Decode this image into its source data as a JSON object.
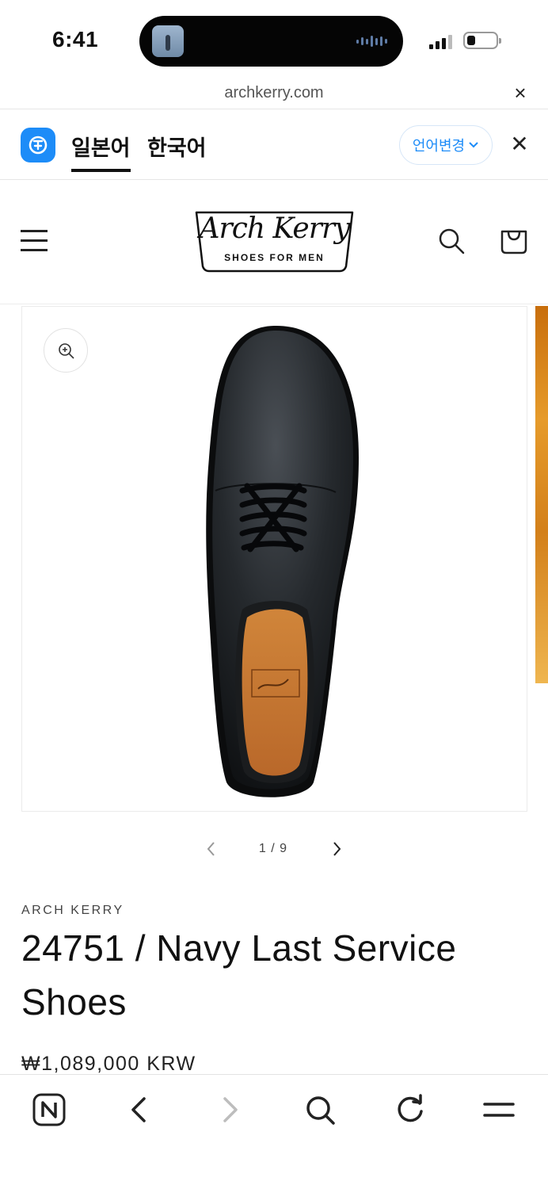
{
  "status_bar": {
    "time": "6:41"
  },
  "url_bar": {
    "domain": "archkerry.com",
    "close_glyph": "×"
  },
  "translate_bar": {
    "source_lang": "일본어",
    "target_lang": "한국어",
    "change_label": "언어변경",
    "close_glyph": "✕",
    "accent_color": "#1d8cf8"
  },
  "site_header": {
    "logo_script": "Arch Kerry",
    "logo_tagline": "SHOES FOR MEN"
  },
  "product": {
    "image_description_icon": "shoe-image",
    "slider": {
      "counter": "1 / 9"
    },
    "vendor": "ARCH KERRY",
    "title": "24751 / Navy Last Service Shoes",
    "price": "₩1,089,000 KRW"
  },
  "icons": {
    "menu": "hamburger-icon",
    "search": "search-icon",
    "cart": "cart-icon",
    "zoom": "zoom-in-icon",
    "browser_home": "naver-n-icon",
    "browser_back": "chevron-left-icon",
    "browser_forward": "chevron-right-icon",
    "browser_search": "search-icon",
    "browser_refresh": "refresh-icon",
    "browser_menu": "menu-icon"
  }
}
